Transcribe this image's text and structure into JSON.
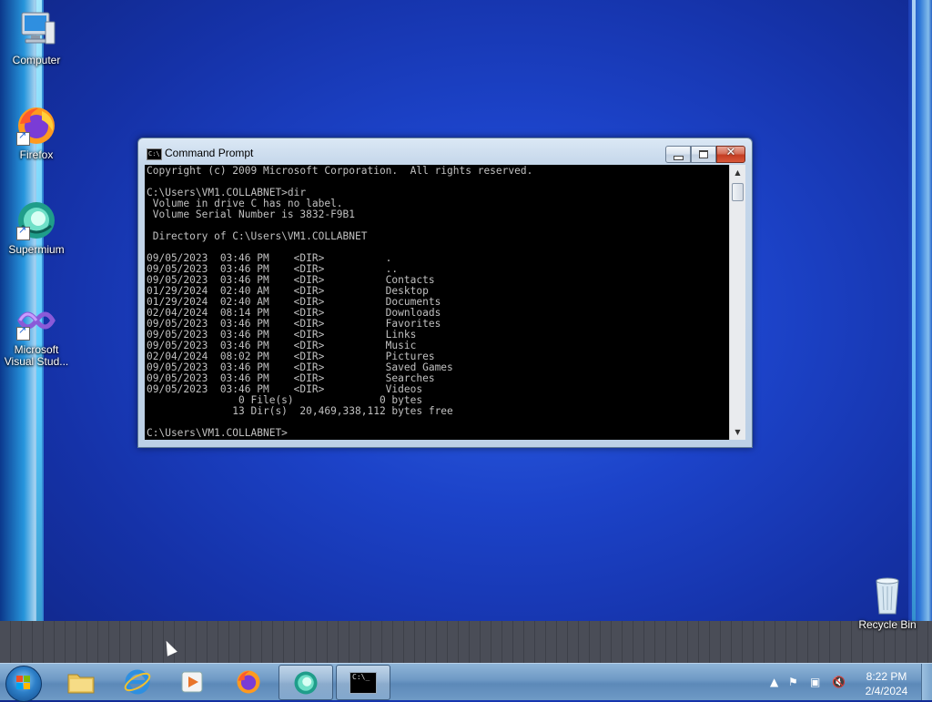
{
  "desktop": {
    "icons": [
      {
        "label": "Computer"
      },
      {
        "label": "Firefox"
      },
      {
        "label": "Supermium"
      },
      {
        "label": "Microsoft Visual Stud..."
      },
      {
        "label": "Recycle Bin"
      }
    ]
  },
  "window": {
    "title": "Command Prompt",
    "console_lines": [
      "Copyright (c) 2009 Microsoft Corporation.  All rights reserved.",
      "",
      "C:\\Users\\VM1.COLLABNET>dir",
      " Volume in drive C has no label.",
      " Volume Serial Number is 3832-F9B1",
      "",
      " Directory of C:\\Users\\VM1.COLLABNET",
      "",
      "09/05/2023  03:46 PM    <DIR>          .",
      "09/05/2023  03:46 PM    <DIR>          ..",
      "09/05/2023  03:46 PM    <DIR>          Contacts",
      "01/29/2024  02:40 AM    <DIR>          Desktop",
      "01/29/2024  02:40 AM    <DIR>          Documents",
      "02/04/2024  08:14 PM    <DIR>          Downloads",
      "09/05/2023  03:46 PM    <DIR>          Favorites",
      "09/05/2023  03:46 PM    <DIR>          Links",
      "09/05/2023  03:46 PM    <DIR>          Music",
      "02/04/2024  08:02 PM    <DIR>          Pictures",
      "09/05/2023  03:46 PM    <DIR>          Saved Games",
      "09/05/2023  03:46 PM    <DIR>          Searches",
      "09/05/2023  03:46 PM    <DIR>          Videos",
      "               0 File(s)              0 bytes",
      "              13 Dir(s)  20,469,338,112 bytes free",
      "",
      "C:\\Users\\VM1.COLLABNET>"
    ]
  },
  "taskbar": {
    "clock_time": "8:22 PM",
    "clock_date": "2/4/2024",
    "items": [
      "start-orb",
      "file-explorer",
      "internet-explorer",
      "media-player",
      "firefox",
      "supermium",
      "command-prompt"
    ]
  },
  "colors": {
    "console_bg": "#000000",
    "console_fg": "#c0c0c0",
    "desktop_blue": "#1c43c9"
  }
}
